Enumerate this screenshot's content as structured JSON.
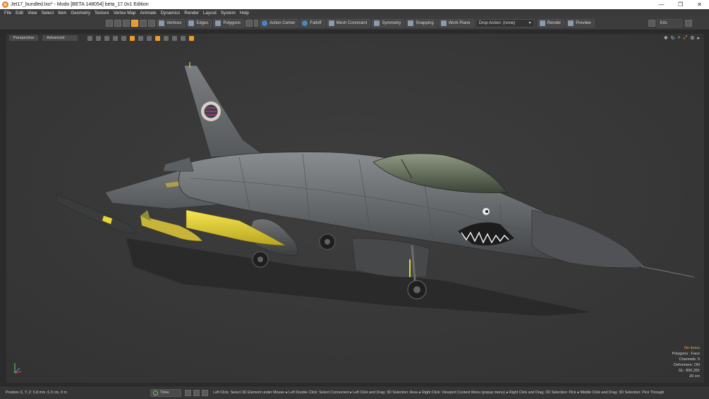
{
  "window": {
    "title": "Jet17_bundled.lxo* - Modo [BETA 148054]  beta_17.0v1 Edition",
    "controls": [
      "—",
      "❐",
      "✕"
    ]
  },
  "menu": [
    "File",
    "Edit",
    "View",
    "Select",
    "Item",
    "Geometry",
    "Texture",
    "Vertex Map",
    "Animate",
    "Dynamics",
    "Render",
    "Layout",
    "System",
    "Help"
  ],
  "toolbar": {
    "vertices": "Vertices",
    "edges": "Edges",
    "polygons": "Polygons",
    "action_center": "Action Center",
    "falloff": "Falloff",
    "mesh_constraint": "Mesh Constraint",
    "symmetry": "Symmetry",
    "snapping": "Snapping",
    "work_plane": "Work Plane",
    "drop_action": "Drop Action: (none)",
    "render": "Render",
    "preview": "Preview",
    "kits": "Kits"
  },
  "viewport": {
    "view_mode": "Perspective",
    "shading": "Advanced",
    "info": {
      "selection": "No Items",
      "polygons": "Polygons : Face",
      "channels": "Channels: 0",
      "deformers": "Deformers: ON",
      "gl": "GL: 890,281",
      "grid": "20 cm"
    }
  },
  "status": {
    "position": "Position X, Y, Z:  5.8 mm, 6.3 cm, 0 m",
    "time_label": "Time",
    "hints": "Left Click: Select 3D Element under Mouse ● Left Double Click: Select Connected ● Left Click and Drag: 3D Selection: Area ● Right Click: Viewport Context Menu (popup menu) ● Right Click and Drag: 3D Selection: Pick ● Middle Click and Drag: 3D Selection: Pick Through"
  },
  "colors": {
    "accent": "#e99a2c",
    "viewport_bg": "#393939",
    "jet_body": "#6c6f72",
    "missile_yellow": "#e8d631"
  }
}
